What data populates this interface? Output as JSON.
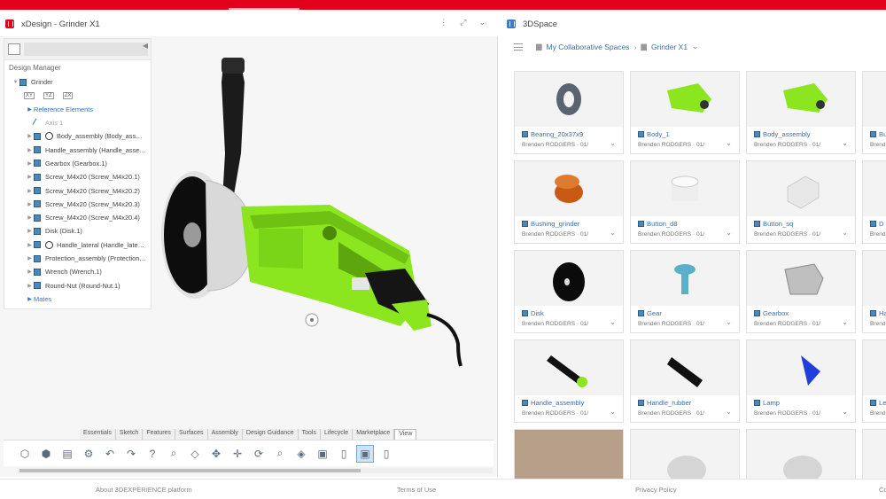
{
  "left_panel": {
    "title": "xDesign - Grinder X1",
    "design_manager_label": "Design Manager",
    "tree": [
      {
        "label": "Grinder",
        "kind": "root"
      },
      {
        "label": "Reference Elements",
        "kind": "link"
      },
      {
        "label": "Axis 1",
        "kind": "axis"
      },
      {
        "label": "Body_assembly (Body_ass…",
        "kind": "assembly"
      },
      {
        "label": "Handle_assembly (Handle_asse…",
        "kind": "part"
      },
      {
        "label": "Gearbox (Gearbox.1)",
        "kind": "part"
      },
      {
        "label": "Screw_M4x20 (Screw_M4x20.1)",
        "kind": "part"
      },
      {
        "label": "Screw_M4x20 (Screw_M4x20.2)",
        "kind": "part"
      },
      {
        "label": "Screw_M4x20 (Screw_M4x20.3)",
        "kind": "part"
      },
      {
        "label": "Screw_M4x20 (Screw_M4x20.4)",
        "kind": "part"
      },
      {
        "label": "Disk (Disk.1)",
        "kind": "part"
      },
      {
        "label": "Handle_lateral (Handle_late…",
        "kind": "assembly"
      },
      {
        "label": "Protection_assembly (Protection…",
        "kind": "part"
      },
      {
        "label": "Wrench (Wrench.1)",
        "kind": "part"
      },
      {
        "label": "Round-Nut (Round-Nut.1)",
        "kind": "part"
      },
      {
        "label": "Mates",
        "kind": "link"
      }
    ],
    "plane_labels": [
      "XY",
      "YZ",
      "ZX"
    ],
    "tabs": [
      "Essentials",
      "Sketch",
      "Features",
      "Surfaces",
      "Assembly",
      "Design Guidance",
      "Tools",
      "Lifecycle",
      "Marketplace",
      "View"
    ],
    "active_tab": "View"
  },
  "right_panel": {
    "title": "3DSpace",
    "breadcrumb": [
      "My Collaborative Spaces",
      "Grinder X1"
    ],
    "cards": [
      {
        "name": "Bearing_20x37x9",
        "owner": "Brenden RODGERS · 01/",
        "thumb": "ring"
      },
      {
        "name": "Body_1",
        "owner": "Brenden RODGERS · 01/",
        "thumb": "green-body"
      },
      {
        "name": "Body_assembly",
        "owner": "Brenden RODGERS · 01/",
        "thumb": "green-body"
      },
      {
        "name": "Bu",
        "owner": "Brend",
        "thumb": "none"
      },
      {
        "name": "Bushing_grinder",
        "owner": "Brenden RODGERS · 01/",
        "thumb": "bushing"
      },
      {
        "name": "Button_d8",
        "owner": "Brenden RODGERS · 01/",
        "thumb": "cylinder"
      },
      {
        "name": "Button_sq",
        "owner": "Brenden RODGERS · 01/",
        "thumb": "box"
      },
      {
        "name": "D",
        "owner": "Brend",
        "thumb": "none"
      },
      {
        "name": "Disk",
        "owner": "Brenden RODGERS · 01/",
        "thumb": "disk"
      },
      {
        "name": "Gear",
        "owner": "Brenden RODGERS · 01/",
        "thumb": "gear"
      },
      {
        "name": "Gearbox",
        "owner": "Brenden RODGERS · 01/",
        "thumb": "gearbox"
      },
      {
        "name": "Ha",
        "owner": "Brend",
        "thumb": "none"
      },
      {
        "name": "Handle_assembly",
        "owner": "Brenden RODGERS · 01/",
        "thumb": "handle-green"
      },
      {
        "name": "Handle_rubber",
        "owner": "Brenden RODGERS · 01/",
        "thumb": "handle-black"
      },
      {
        "name": "Lamp",
        "owner": "Brenden RODGERS · 01/",
        "thumb": "lamp"
      },
      {
        "name": "Le",
        "owner": "Brend",
        "thumb": "none"
      }
    ]
  },
  "footer": {
    "about": "About 3DEXPERIENCE platform",
    "terms": "Terms of Use",
    "privacy": "Privacy Policy",
    "more": "Co"
  },
  "colors": {
    "brand_red": "#e3001b",
    "grinder_green": "#8be51f",
    "link_blue": "#3f6ea5"
  }
}
